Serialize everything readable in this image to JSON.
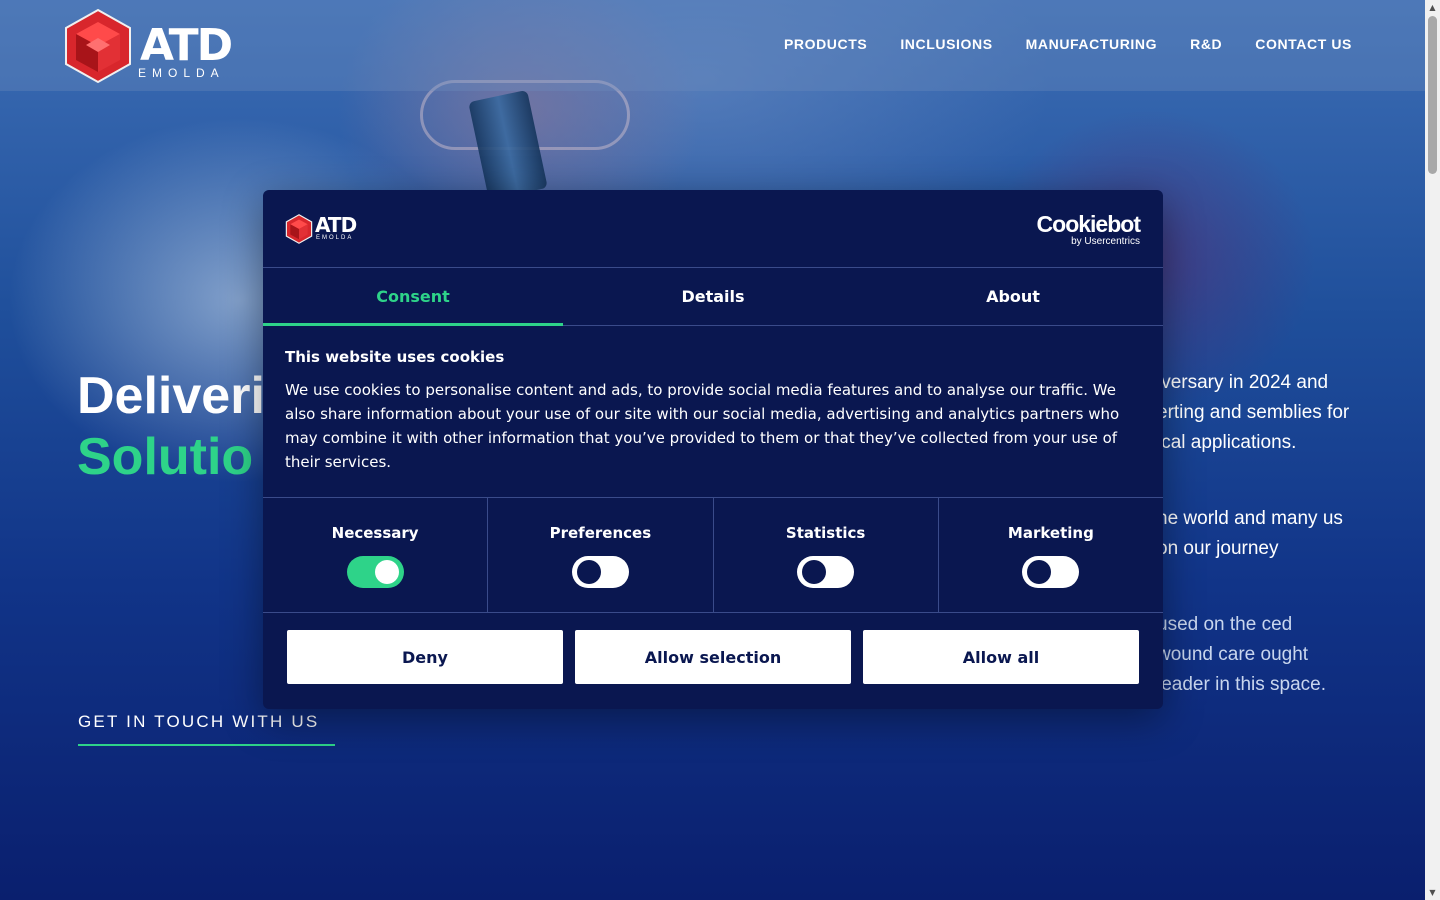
{
  "site": {
    "logo_text": "ATD",
    "logo_sub": "EMOLDA",
    "nav": [
      "PRODUCTS",
      "INCLUSIONS",
      "MANUFACTURING",
      "R&D",
      "CONTACT US"
    ]
  },
  "hero": {
    "title_line1": "Deliveri",
    "title_line2": "Solutio",
    "cta": "GET IN TOUCH WITH US",
    "para1": "iversary in 2024 and erting and semblies for ical applications.",
    "para2": "he world and many us on our journey",
    "para3": "used on the ced wound care ought leader in this space."
  },
  "dialog": {
    "logo_text": "ATD",
    "logo_sub": "EMOLDA",
    "provider_main": "Cookiebot",
    "provider_sub": "by Usercentrics",
    "tabs": [
      "Consent",
      "Details",
      "About"
    ],
    "heading": "This website uses cookies",
    "body": "We use cookies to personalise content and ads, to provide social media features and to analyse our traffic. We also share information about your use of our site with our social media, advertising and analytics partners who may combine it with other information that you’ve provided to them or that they’ve collected from your use of their services.",
    "toggles": [
      {
        "label": "Necessary",
        "on": true
      },
      {
        "label": "Preferences",
        "on": false
      },
      {
        "label": "Statistics",
        "on": false
      },
      {
        "label": "Marketing",
        "on": false
      }
    ],
    "buttons": [
      "Deny",
      "Allow selection",
      "Allow all"
    ]
  },
  "colors": {
    "accent": "#2ed389",
    "dialog_bg": "#0a1750",
    "hero_bg": "#113488"
  }
}
